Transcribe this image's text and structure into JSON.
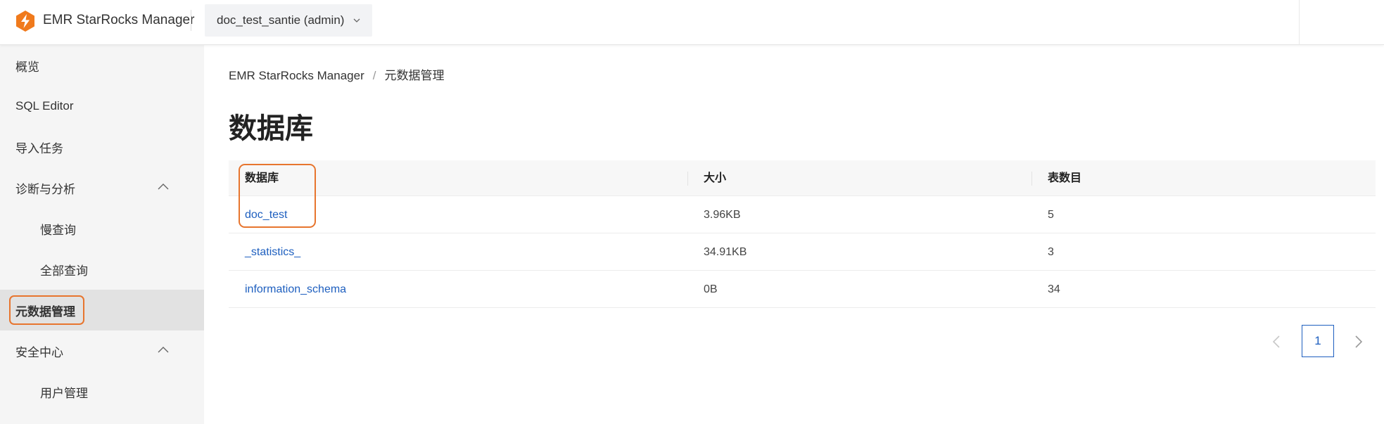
{
  "header": {
    "app_title": "EMR StarRocks Manager",
    "cluster_selector": "doc_test_santie (admin)",
    "brand_color": "#f07a1c"
  },
  "sidebar": {
    "items": [
      {
        "label": "概览"
      },
      {
        "label": "SQL Editor"
      },
      {
        "label": "导入任务"
      },
      {
        "label": "诊断与分析",
        "expanded": true
      },
      {
        "label": "慢查询"
      },
      {
        "label": "全部查询"
      },
      {
        "label": "元数据管理",
        "active": true
      },
      {
        "label": "安全中心",
        "expanded": true
      },
      {
        "label": "用户管理"
      }
    ]
  },
  "breadcrumb": {
    "root": "EMR StarRocks Manager",
    "separator": "/",
    "current": "元数据管理"
  },
  "page": {
    "title": "数据库"
  },
  "table": {
    "columns": [
      "数据库",
      "大小",
      "表数目"
    ],
    "rows": [
      {
        "name": "doc_test",
        "size": "3.96KB",
        "tables": "5"
      },
      {
        "name": "_statistics_",
        "size": "34.91KB",
        "tables": "3"
      },
      {
        "name": "information_schema",
        "size": "0B",
        "tables": "34"
      }
    ]
  },
  "pagination": {
    "current_page": "1",
    "accent_color": "#1e5fbf"
  },
  "annotation_color": "#e7752e"
}
